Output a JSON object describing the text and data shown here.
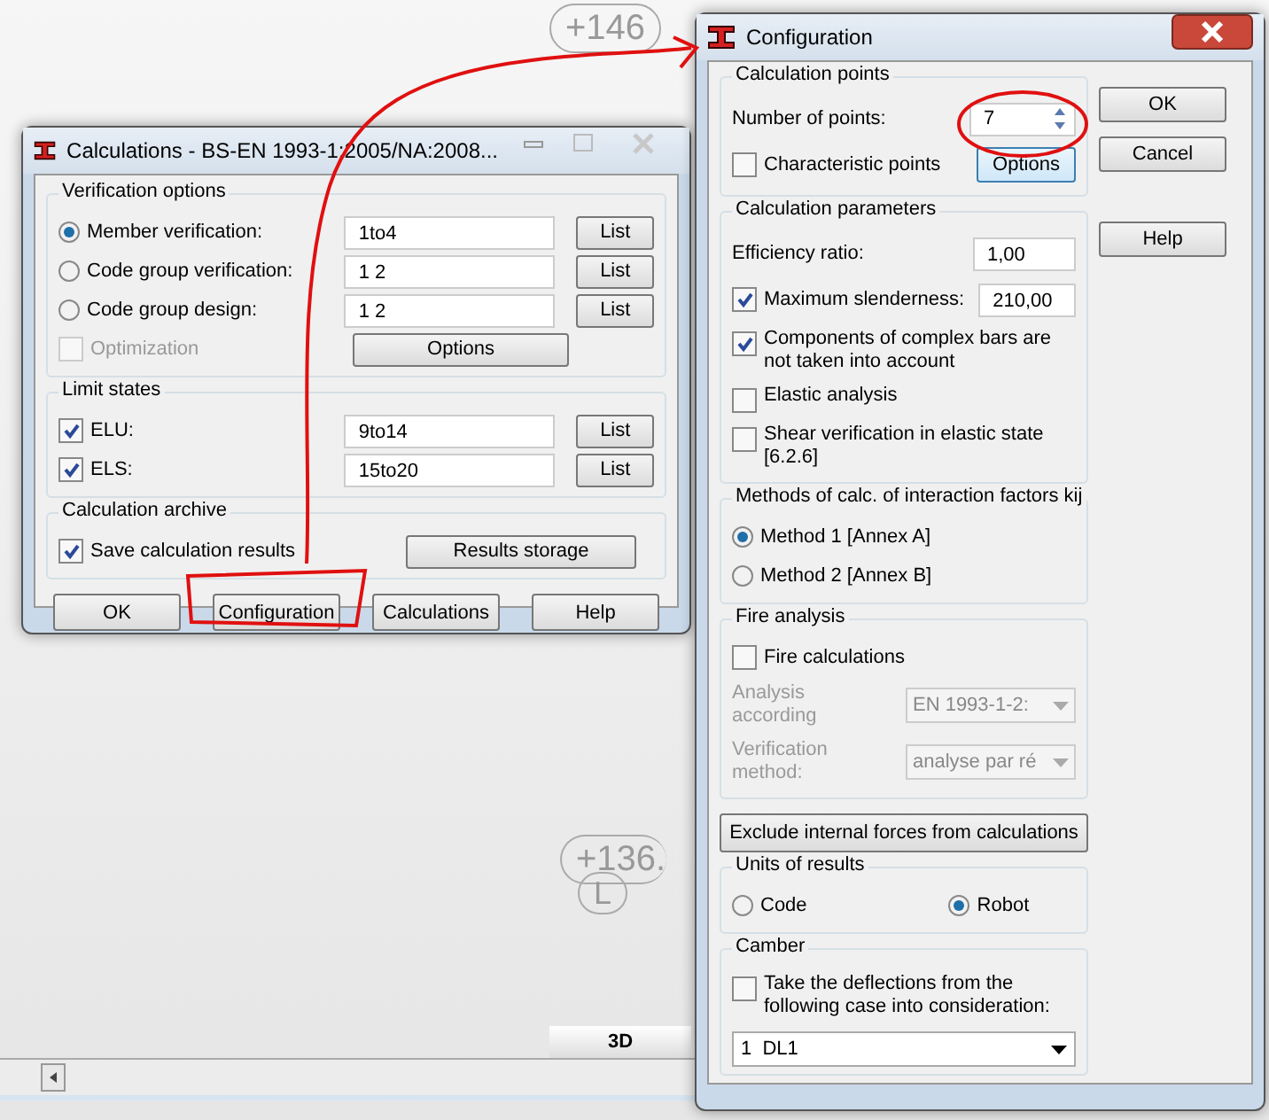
{
  "canvas": {
    "labels": [
      {
        "text": "+146"
      },
      {
        "text": "+136."
      },
      {
        "text": "L"
      }
    ],
    "view_tab": "3D"
  },
  "calculations_window": {
    "title": "Calculations - BS-EN 1993-1:2005/NA:2008...",
    "verification_options": {
      "title": "Verification options",
      "options": [
        {
          "label": "Member verification:",
          "selected": true,
          "value": "1to4",
          "button": "List"
        },
        {
          "label": "Code group verification:",
          "selected": false,
          "value": "1 2",
          "button": "List"
        },
        {
          "label": "Code group design:",
          "selected": false,
          "value": "1 2",
          "button": "List"
        }
      ],
      "optimization": {
        "label": "Optimization",
        "checked": false,
        "disabled": true
      },
      "options_button": "Options"
    },
    "limit_states": {
      "title": "Limit states",
      "items": [
        {
          "label": "ELU:",
          "checked": true,
          "value": "9to14",
          "button": "List"
        },
        {
          "label": "ELS:",
          "checked": true,
          "value": "15to20",
          "button": "List"
        }
      ]
    },
    "archive": {
      "title": "Calculation archive",
      "save": {
        "label": "Save calculation results",
        "checked": true
      },
      "button": "Results storage"
    },
    "buttons": [
      "OK",
      "Configuration",
      "Calculations",
      "Help"
    ]
  },
  "configuration_window": {
    "title": "Configuration",
    "calculation_points": {
      "title": "Calculation points",
      "number_label": "Number of points:",
      "number_value": "7",
      "characteristic": {
        "label": "Characteristic points",
        "checked": false
      },
      "options_button": "Options"
    },
    "side_buttons": [
      "OK",
      "Cancel",
      "Help"
    ],
    "parameters": {
      "title": "Calculation parameters",
      "efficiency": {
        "label": "Efficiency ratio:",
        "value": "1,00"
      },
      "slenderness": {
        "label": "Maximum slenderness:",
        "checked": true,
        "value": "210,00"
      },
      "checks": [
        {
          "label": "Components of complex bars are not taken into account",
          "checked": true
        },
        {
          "label": "Elastic analysis",
          "checked": false
        },
        {
          "label": "Shear verification in elastic state [6.2.6]",
          "checked": false
        }
      ]
    },
    "interaction": {
      "title": "Methods of calc. of interaction factors kij",
      "options": [
        {
          "label": "Method 1 [Annex A]",
          "selected": true
        },
        {
          "label": "Method 2 [Annex B]",
          "selected": false
        }
      ]
    },
    "fire": {
      "title": "Fire analysis",
      "fire_calc": {
        "label": "Fire calculations",
        "checked": false
      },
      "selects": [
        {
          "label": "Analysis according",
          "value": "EN 1993-1-2:",
          "disabled": true
        },
        {
          "label": "Verification method:",
          "value": "analyse par ré",
          "disabled": true
        }
      ]
    },
    "exclude_button": "Exclude internal forces from calculations",
    "units": {
      "title": "Units of results",
      "options": [
        {
          "label": "Code",
          "selected": false
        },
        {
          "label": "Robot",
          "selected": true
        }
      ]
    },
    "camber": {
      "title": "Camber",
      "checkbox": {
        "label": "Take the deflections from the following case into consideration:",
        "checked": false
      },
      "select_value": "1  DL1"
    }
  }
}
